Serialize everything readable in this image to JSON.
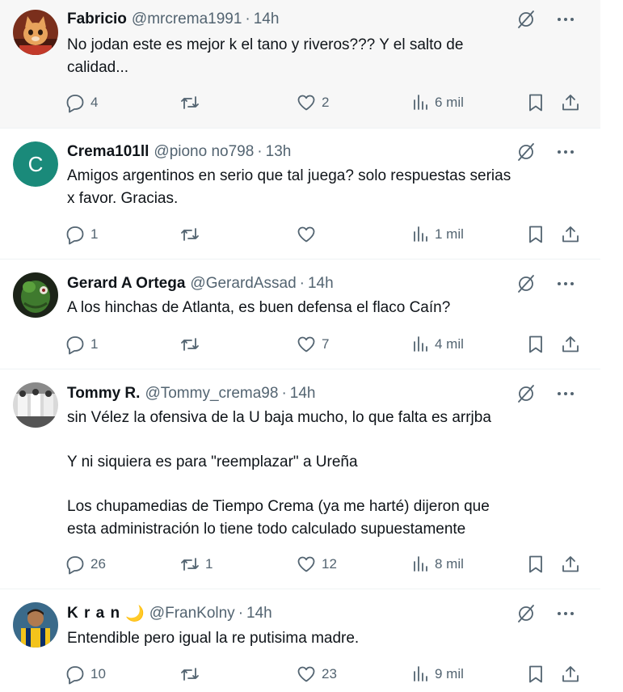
{
  "tweets": [
    {
      "name": "Fabricio",
      "handle": "@mrcrema1991",
      "time": "14h",
      "text": "No jodan este es mejor k el tano y riveros??? Y el salto de\ncalidad...",
      "replies": "4",
      "retweets": "",
      "likes": "2",
      "views": "6 mil",
      "avatar": "cat-avatar"
    },
    {
      "name": "Crema101ll",
      "handle": "@piono no798",
      "time": "13h",
      "text": "Amigos argentinos en serio que tal juega? solo respuestas serias\nx favor. Gracias.",
      "replies": "1",
      "retweets": "",
      "likes": "",
      "views": "1 mil",
      "avatar": "letter-avatar",
      "avatar_letter": "C",
      "avatar_color": "#1a8a7a"
    },
    {
      "name": "Gerard A Ortega",
      "handle": "@GerardAssad",
      "time": "14h",
      "text": "A los hinchas de Atlanta, es buen defensa el flaco Caín?",
      "replies": "1",
      "retweets": "",
      "likes": "7",
      "views": "4 mil",
      "avatar": "plant-avatar"
    },
    {
      "name": "Tommy R.",
      "handle": "@Tommy_crema98",
      "time": "14h",
      "text": "sin Vélez la ofensiva de la U baja mucho, lo que falta es arrjba\n\nY ni siquiera es para \"reemplazar\" a Ureña\n\nLos chupamedias de Tiempo Crema (ya me harté) dijeron que\nesta administración lo tiene todo calculado supuestamente",
      "replies": "26",
      "retweets": "1",
      "likes": "12",
      "views": "8 mil",
      "avatar": "team-photo-avatar"
    },
    {
      "name": "K r a n",
      "name_emoji": "🌙",
      "handle": "@FranKolny",
      "time": "14h",
      "text": "Entendible pero igual la re putisima madre.",
      "replies": "10",
      "retweets": "",
      "likes": "23",
      "views": "9 mil",
      "avatar": "player-avatar"
    }
  ],
  "separator": "·",
  "icons": [
    "reply-icon",
    "retweet-icon",
    "like-icon",
    "views-icon",
    "bookmark-icon",
    "share-icon",
    "grok-icon",
    "more-icon"
  ]
}
